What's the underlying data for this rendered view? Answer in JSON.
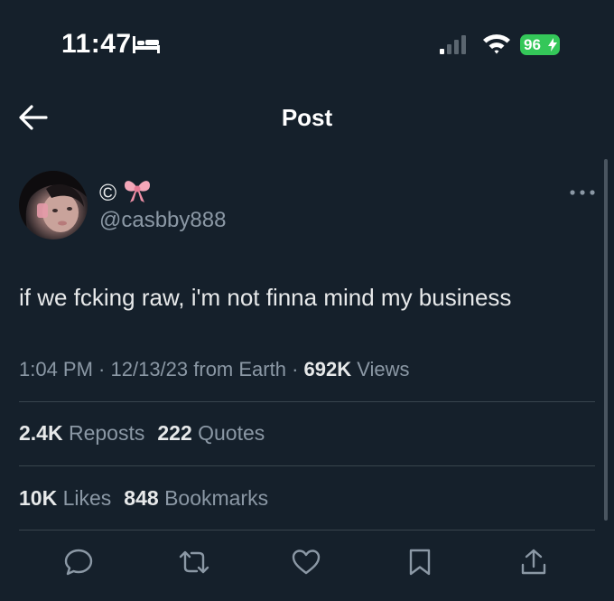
{
  "status_bar": {
    "time": "11:47",
    "battery": "96",
    "icons": [
      "bed-icon",
      "signal-icon",
      "wifi-icon",
      "battery-icon",
      "bolt-icon"
    ]
  },
  "header": {
    "title": "Post",
    "back_icon": "arrow-left-icon"
  },
  "author": {
    "display_name_prefix": "©",
    "display_name_emoji": "bow-icon",
    "handle": "@casbby888",
    "more_icon": "more-horizontal-icon"
  },
  "tweet": {
    "text": "if we fcking raw, i'm not finna mind my business"
  },
  "meta": {
    "time": "1:04 PM",
    "sep1": " · ",
    "date": "12/13/23",
    "source": " from Earth",
    "sep2": " · ",
    "views_count": "692K",
    "views_label": " Views"
  },
  "stats": {
    "reposts_count": "2.4K",
    "reposts_label": "Reposts",
    "quotes_count": "222",
    "quotes_label": "Quotes",
    "likes_count": "10K",
    "likes_label": "Likes",
    "bookmarks_count": "848",
    "bookmarks_label": "Bookmarks"
  },
  "actions": [
    "reply-icon",
    "repost-icon",
    "like-icon",
    "bookmark-icon",
    "share-icon"
  ],
  "colors": {
    "background": "#15202b",
    "text": "#e7e9ea",
    "secondary": "#8b98a5",
    "divider": "#38444d",
    "battery": "#34c759"
  }
}
